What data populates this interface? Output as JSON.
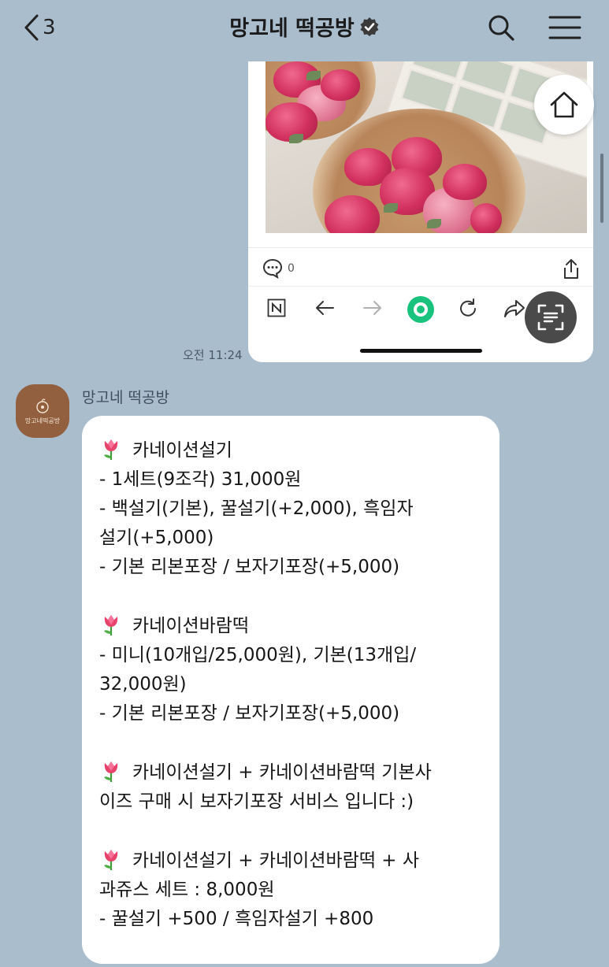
{
  "header": {
    "back_count": "3",
    "title": "망고네 떡공방"
  },
  "shared_post": {
    "comment_count": "0",
    "sent_time": "오전 11:24"
  },
  "message": {
    "sender": "망고네 떡공방",
    "avatar_text": "망고네떡공방",
    "blocks": [
      {
        "title": "카네이션설기",
        "lines": [
          "- 1세트(9조각) 31,000원",
          "- 백설기(기본), 꿀설기(+2,000), 흑임자",
          "설기(+5,000)",
          "- 기본 리본포장 / 보자기포장(+5,000)"
        ]
      },
      {
        "title": "카네이션바람떡",
        "lines": [
          "- 미니(10개입/25,000원), 기본(13개입/",
          "32,000원)",
          "- 기본 리본포장 / 보자기포장(+5,000)"
        ]
      },
      {
        "title": "카네이션설기 + 카네이션바람떡 기본사",
        "lines": [
          "이즈 구매 시 보자기포장 서비스 입니다 :)"
        ]
      },
      {
        "title": "카네이션설기 + 카네이션바람떡 + 사",
        "lines": [
          "과쥬스 세트 : 8,000원",
          "- 꿀설기 +500 / 흑임자설기 +800"
        ]
      }
    ]
  },
  "icons": {
    "back": "chevron-left-icon",
    "verified": "verified-badge-icon",
    "search": "search-icon",
    "menu": "hamburger-menu-icon",
    "home": "home-icon",
    "comment": "comment-icon",
    "share": "share-icon",
    "naver": "naver-icon",
    "browser_back": "arrow-left-icon",
    "browser_forward": "arrow-right-icon",
    "green_dot": "green-circle-icon",
    "reload": "reload-icon",
    "forward_share": "forward-icon",
    "scan": "scan-text-icon",
    "tulip": "tulip-emoji-icon"
  },
  "colors": {
    "chat_background": "#a9bdcd",
    "bubble": "#ffffff",
    "avatar": "#93603f",
    "accent_green": "#19c37d"
  }
}
